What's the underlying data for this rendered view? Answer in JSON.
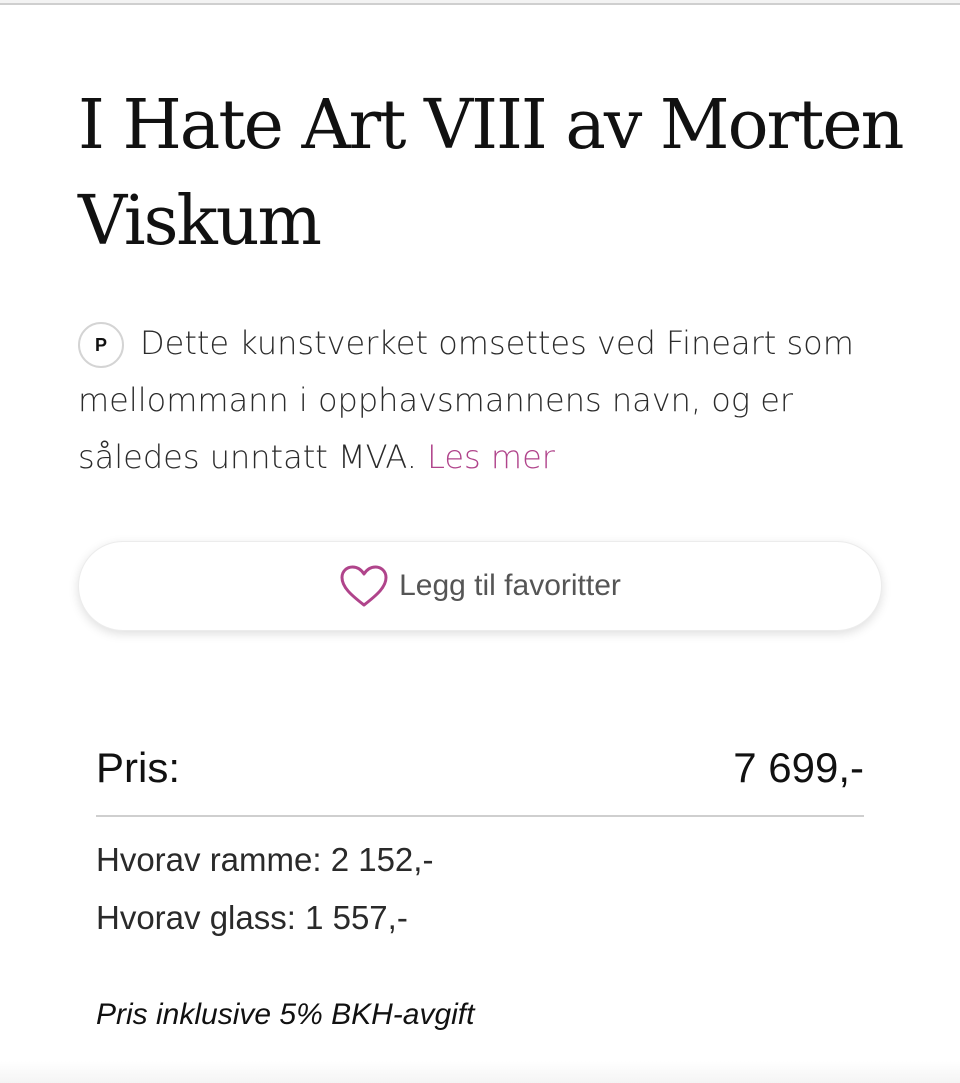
{
  "product": {
    "title": "I Hate Art VIII av Morten Viskum"
  },
  "vat_notice": {
    "badge": "P",
    "text": "Dette kunstverket omsettes ved Fineart som mellommann i opphavsmannens navn, og er således unntatt MVA.",
    "read_more": "Les mer"
  },
  "favorite": {
    "label": "Legg til favoritter",
    "icon": "heart-icon",
    "icon_color": "#b0448b"
  },
  "price": {
    "label": "Pris:",
    "value": "7 699,-",
    "frame": "Hvorav ramme: 2 152,-",
    "glass": "Hvorav glass: 1 557,-",
    "fee_note": "Pris inklusive 5% BKH-avgift"
  },
  "colors": {
    "accent": "#b0448b",
    "text": "#111111"
  }
}
